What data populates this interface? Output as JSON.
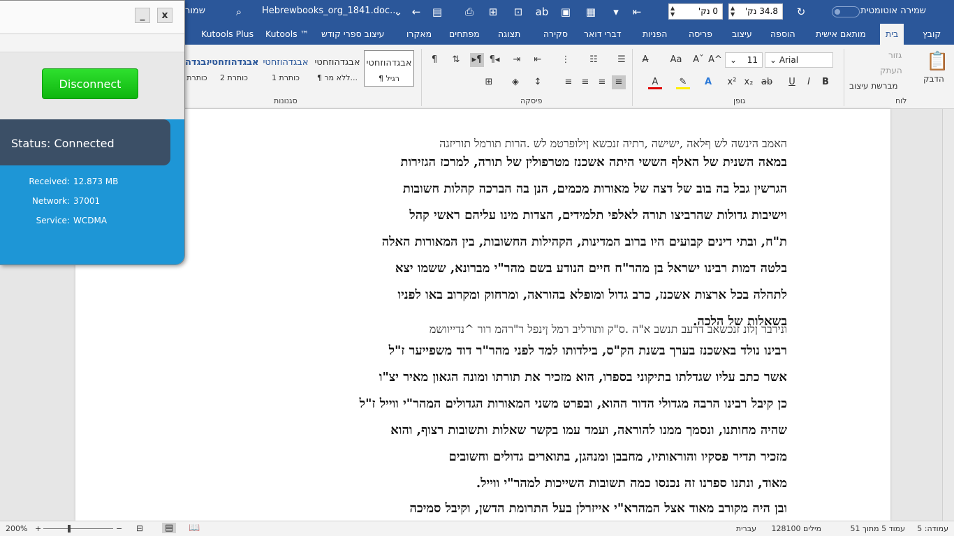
{
  "titlebar": {
    "autosave_label": "שמירה אוטומטית",
    "spacing_after": "0 נק'",
    "spacing_before": "34.8 נק'",
    "filename": "Hebrewbooks_org_1841.doc...",
    "save_as_label": "שמור"
  },
  "tabs": [
    "קובץ",
    "בית",
    "מותאם אישית",
    "הוספה",
    "עיצוב",
    "פריסה",
    "הפניות",
    "דברי דואר",
    "סקירה",
    "תצוגה",
    "מפתחים",
    "מאקרו",
    "עיצוב ספרי קודש",
    "Kutools ™",
    "Kutools Plus"
  ],
  "ribbon": {
    "clipboard": {
      "label": "לוח",
      "paste": "הדבק",
      "cut": "גזור",
      "copy": "העתק",
      "format_painter": "מברשת עיצוב"
    },
    "font": {
      "label": "גופן",
      "font_name": "Arial",
      "font_size": "11"
    },
    "paragraph": {
      "label": "פיסקה"
    },
    "styles": {
      "label": "סגנונות",
      "items": [
        {
          "sample": "אבגדהוזחטי",
          "name": "¶ רגיל"
        },
        {
          "sample": "אבגדהוזחטי",
          "name": "¶ ללא מר..."
        },
        {
          "sample": "אבגדהוזחטי",
          "name": "כותרת 1"
        },
        {
          "sample": "אבגדהוזחטי",
          "name": "כותרת 2"
        },
        {
          "sample": "אבגדה",
          "name": "כותרת"
        }
      ]
    }
  },
  "document": {
    "lines": [
      {
        "text": "האמב הינשה לש ףלאה ,ישישה ,רתיה זנכשא ןילופרטמ לש .הרות תורמל תוריזגה",
        "style": "r"
      },
      {
        "text": "במאה השנית של האלף הששי היתה אשכנז מטרפולין של תורה, למרכז הגזירות",
        "style": "b"
      },
      {
        "text": "הגרשין גבל בה בוב של דצה של מאורות מכמים, הנן בה הברכה קהלות חשובות",
        "style": "b"
      },
      {
        "text": "וישיבות גדולות שהרביצו תורה לאלפי תלמידים, הצדות מינו עליהם ראשי קהל",
        "style": "b"
      },
      {
        "text": "ת\"ח, ובתי דינים קבועים היו ברוב המדינות, הקהילות החשובות, בין המאורות האלה",
        "style": "b"
      },
      {
        "text": "בלטה דמות רבינו ישראל בן מהר\"ח חיים הנודע בשם מהר\"י מברונא, ששמו יצא",
        "style": "b"
      },
      {
        "text": "לתהלה בכל ארצות אשכנז, כרב גדול ומופלא בהוראה, ומרחוק ומקרוב באו לפניו",
        "style": "b"
      },
      {
        "text": "בשאלות של הלכה.",
        "style": "b"
      },
      {
        "text": "ונירבר ןלונ זנכשאב דרעב תנשב א\"ה .ס\"ק ותורליב רמל ןינפל ר\"רהמ רור ^נדייוושמ",
        "style": "r"
      },
      {
        "text": "רבינו נולד באשכנז בערך בשנת הק\"ס, בילדותו למד לפני מהר\"ר דוד משפייער ז\"ל",
        "style": "b"
      },
      {
        "text": "אשר כתב עליו שגדלתו בתיקוני בספרו, הוא מזכיר את תורתו ומונה הגאון מאיר יצ\"ו",
        "style": "b"
      },
      {
        "text": "כן קיבל רבינו הרבה מגדולי הדור ההוא, ובפרט משני המאורות הגדולים המהר\"י ווייל ז\"ל",
        "style": "b"
      },
      {
        "text": "שהיה מחותנו, ונסמך ממנו להוראה, ועמד עמו בקשר שאלות ותשובות רצוף, והוא",
        "style": "b"
      },
      {
        "text": "מזכיר תדיר פסקיו והוראותיו, מחבבן ומנהגן, בתוארים גדולים וחשובים",
        "style": "b"
      },
      {
        "text": "מאוד, ונתנו ספרנו זה נכנסו כמה תשובות השייכות למהר\"י ווייל.",
        "style": "b"
      },
      {
        "text": "ובן היה מקורב מאוד אצל המהרא\"י אייזרלן בעל התרומת הדשן, וקיבל סמיכה",
        "style": "b"
      }
    ]
  },
  "statusbar": {
    "page": "עמוד 5 מתוך 51",
    "section": "עמודה: 5",
    "words": "128100 מילים",
    "language": "עברית",
    "zoom": "200%"
  },
  "vpn": {
    "minimize": "_",
    "close": "x",
    "disconnect_label": "Disconnect",
    "status_text": "Status: Connected",
    "received_label": "Received:",
    "received_value": "12.873 MB",
    "network_label": "Network:",
    "network_value": "37001",
    "service_label": "Service:",
    "service_value": "WCDMA"
  }
}
